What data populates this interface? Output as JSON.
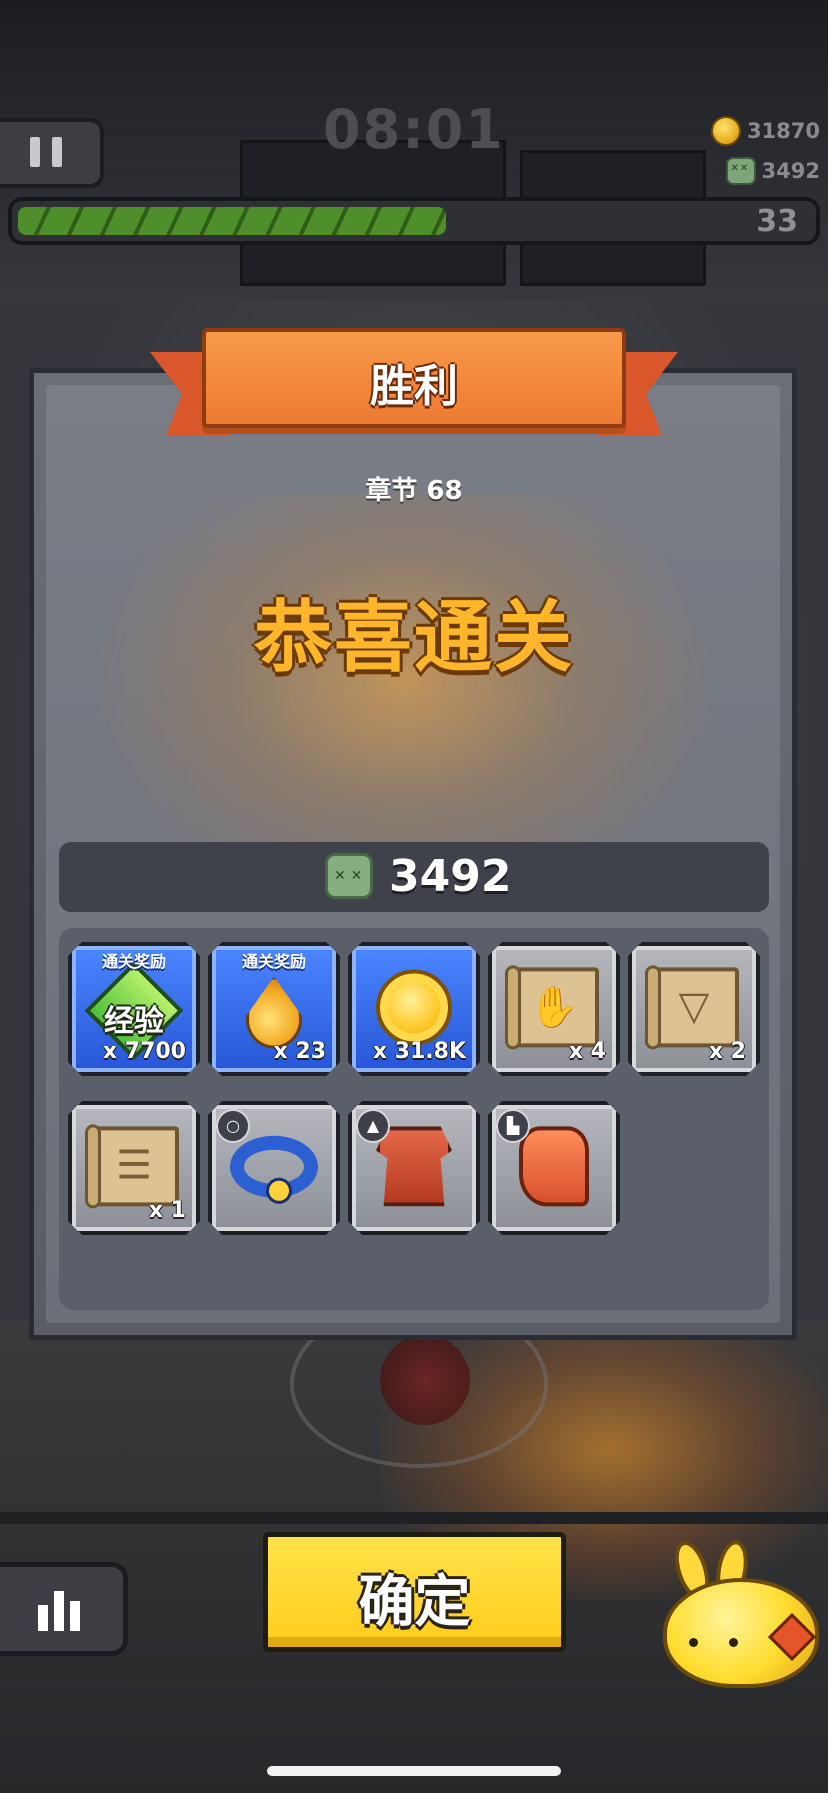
{
  "hud": {
    "timer": "08:01",
    "gold": "31870",
    "kills": "3492",
    "level": "33",
    "progress_fraction": 0.54
  },
  "dialog": {
    "title": "胜利",
    "chapter": "章节 68",
    "headline": "恭喜通关",
    "kill_count": "3492"
  },
  "rewards": [
    {
      "tag": "通关奖励",
      "label": "经验",
      "qty": "x 7700",
      "icon": "xp-icon",
      "style": "blue"
    },
    {
      "tag": "通关奖励",
      "qty": "x 23",
      "icon": "gold-drop-icon",
      "style": "blue"
    },
    {
      "qty": "x 31.8K",
      "icon": "gold-coin-icon",
      "style": "blue"
    },
    {
      "qty": "x 4",
      "icon": "glove-scroll-icon",
      "style": "gray"
    },
    {
      "qty": "x 2",
      "icon": "necklace-scroll-icon",
      "style": "gray"
    },
    {
      "qty": "x 1",
      "icon": "armor-scroll-icon",
      "style": "gray"
    },
    {
      "icon": "collar-equipment-icon",
      "style": "gray"
    },
    {
      "icon": "armor-equipment-icon",
      "style": "gray"
    },
    {
      "icon": "boot-equipment-icon",
      "style": "gray"
    }
  ],
  "buttons": {
    "confirm": "确定"
  },
  "colors": {
    "ribbon": "#ee7a32",
    "headline": "#ffb62b",
    "confirm": "#ffcc1a",
    "reward_blue": "#2756d6",
    "reward_gray": "#8c8f97"
  }
}
